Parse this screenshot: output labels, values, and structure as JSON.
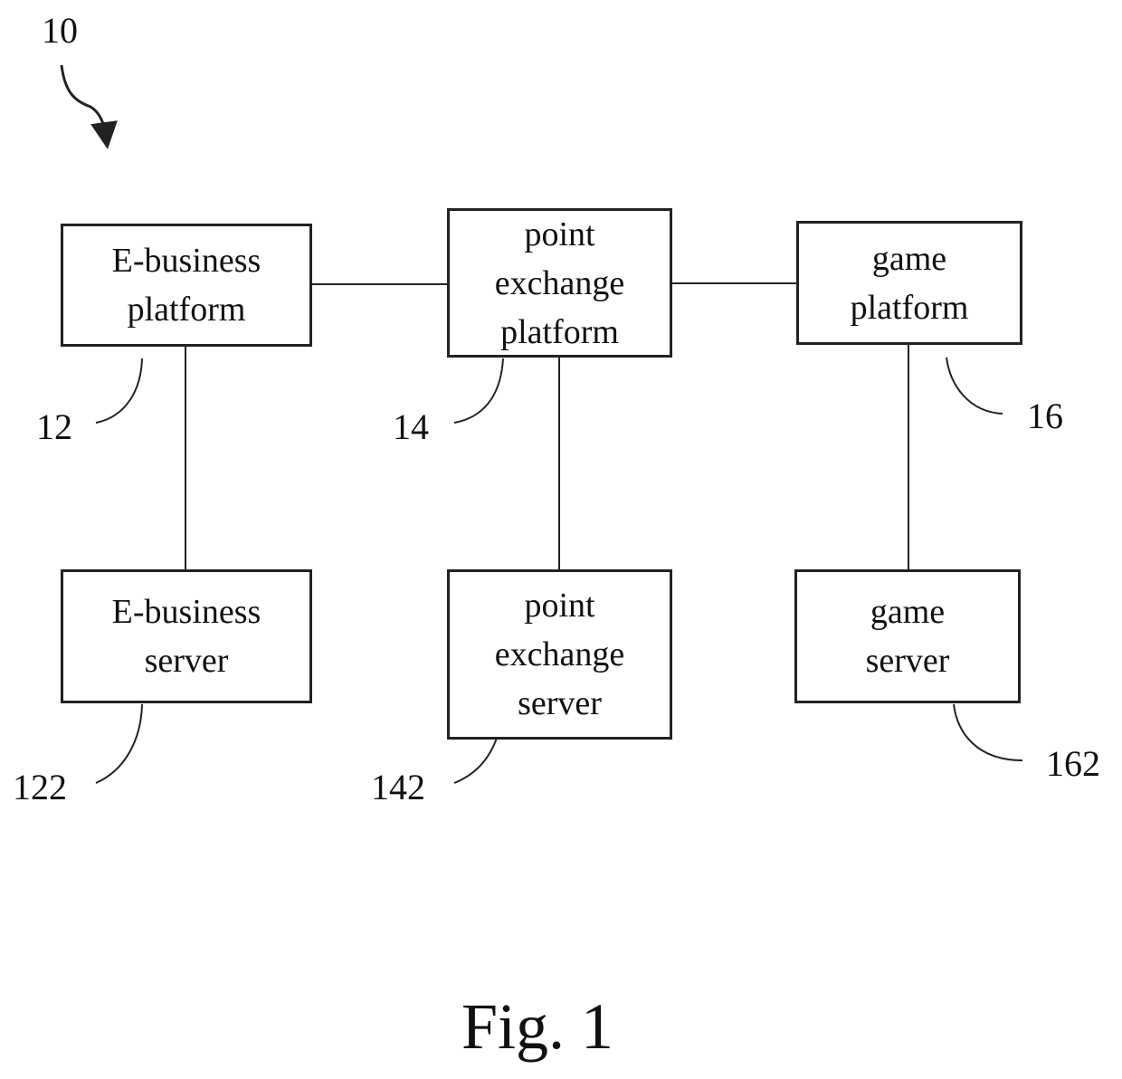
{
  "diagram": {
    "system_ref": "10",
    "caption": "Fig. 1",
    "nodes": {
      "ebusiness_platform": {
        "lines": [
          "E-business",
          "platform"
        ],
        "ref": "12"
      },
      "point_exchange_platform": {
        "lines": [
          "point",
          "exchange",
          "platform"
        ],
        "ref": "14"
      },
      "game_platform": {
        "lines": [
          "game",
          "platform"
        ],
        "ref": "16"
      },
      "ebusiness_server": {
        "lines": [
          "E-business",
          "server"
        ],
        "ref": "122"
      },
      "point_exchange_server": {
        "lines": [
          "point",
          "exchange",
          "server"
        ],
        "ref": "142"
      },
      "game_server": {
        "lines": [
          "game",
          "server"
        ],
        "ref": "162"
      }
    },
    "connections": [
      [
        "ebusiness_platform",
        "point_exchange_platform"
      ],
      [
        "point_exchange_platform",
        "game_platform"
      ],
      [
        "ebusiness_platform",
        "ebusiness_server"
      ],
      [
        "point_exchange_platform",
        "point_exchange_server"
      ],
      [
        "game_platform",
        "game_server"
      ]
    ]
  }
}
